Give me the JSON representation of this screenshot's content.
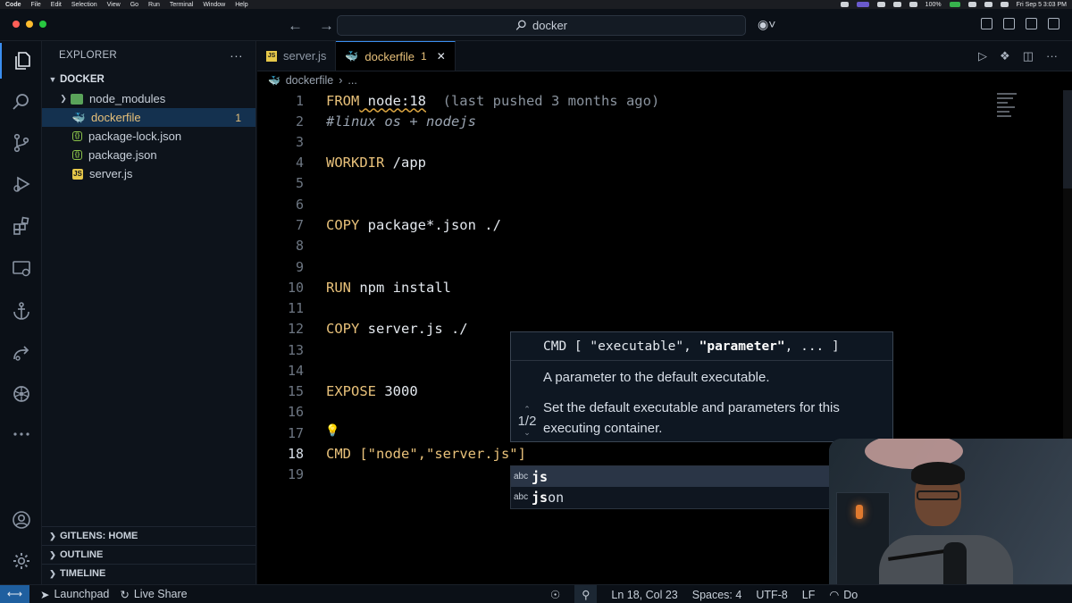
{
  "menubar": {
    "items": [
      "Code",
      "File",
      "Edit",
      "Selection",
      "View",
      "Go",
      "Run",
      "Terminal",
      "Window",
      "Help"
    ],
    "battery": "100%",
    "clock": "Fri Sep 5 3:03 PM"
  },
  "titlebar": {
    "search_text": "docker"
  },
  "activity_bar": {
    "items": [
      "explorer-icon",
      "search-icon",
      "source-control-icon",
      "run-debug-icon",
      "extensions-icon",
      "remote-explorer-icon",
      "docker-anchor-icon",
      "live-share-icon",
      "kubernetes-icon",
      "more-icon",
      "accounts-icon",
      "settings-gear-icon"
    ]
  },
  "sidebar": {
    "header": "EXPLORER",
    "more": "···",
    "folder": "DOCKER",
    "files": [
      {
        "name": "node_modules",
        "type": "folder",
        "badge": ""
      },
      {
        "name": "dockerfile",
        "type": "docker",
        "badge": "1"
      },
      {
        "name": "package-lock.json",
        "type": "json",
        "badge": ""
      },
      {
        "name": "package.json",
        "type": "json",
        "badge": ""
      },
      {
        "name": "server.js",
        "type": "js",
        "badge": ""
      }
    ],
    "sections": [
      "GITLENS: HOME",
      "OUTLINE",
      "TIMELINE"
    ]
  },
  "tabs": [
    {
      "label": "server.js",
      "active": false
    },
    {
      "label": "dockerfile",
      "active": true,
      "problems": "1"
    }
  ],
  "breadcrumbs": {
    "file": "dockerfile",
    "rest": "..."
  },
  "code": {
    "lines": [
      {
        "n": "1",
        "kw": "FROM",
        "rest": " node:18",
        "hint": "  (last pushed 3 months ago)"
      },
      {
        "n": "2",
        "comment": "#linux os + nodejs"
      },
      {
        "n": "3"
      },
      {
        "n": "4",
        "kw": "WORKDIR",
        "rest": " /app"
      },
      {
        "n": "5"
      },
      {
        "n": "6"
      },
      {
        "n": "7",
        "kw": "COPY",
        "rest": " package*.json ./"
      },
      {
        "n": "8"
      },
      {
        "n": "9"
      },
      {
        "n": "10",
        "kw": "RUN",
        "rest": " npm install"
      },
      {
        "n": "11"
      },
      {
        "n": "12",
        "kw": "COPY",
        "rest": " server.js ./"
      },
      {
        "n": "13"
      },
      {
        "n": "14"
      },
      {
        "n": "15",
        "kw": "EXPOSE",
        "rest": " 3000"
      },
      {
        "n": "16"
      },
      {
        "n": "17"
      },
      {
        "n": "18",
        "kw": "CMD",
        "rest": " [\"node\",\"server.js\"]"
      },
      {
        "n": "19"
      }
    ],
    "current_line": "18"
  },
  "hover": {
    "signature_pre": "CMD [ \"executable\", ",
    "signature_param": "\"parameter\"",
    "signature_post": ", ... ]",
    "counter": "1/2",
    "doc_short": "A parameter to the default executable.",
    "doc_long": "Set the default executable and parameters for this executing container."
  },
  "suggest": {
    "items": [
      {
        "kind": "abc",
        "match": "js",
        "rest": ""
      },
      {
        "kind": "abc",
        "match": "js",
        "rest": "on"
      }
    ]
  },
  "statusbar": {
    "launchpad": "Launchpad",
    "live_share": "Live Share",
    "position": "Ln 18, Col 23",
    "spaces": "Spaces: 4",
    "encoding": "UTF-8",
    "eol": "LF",
    "language": "Do"
  },
  "colors": {
    "accent": "#3b8ef0",
    "keyword": "#e8c17a",
    "selection": "#14314f"
  }
}
